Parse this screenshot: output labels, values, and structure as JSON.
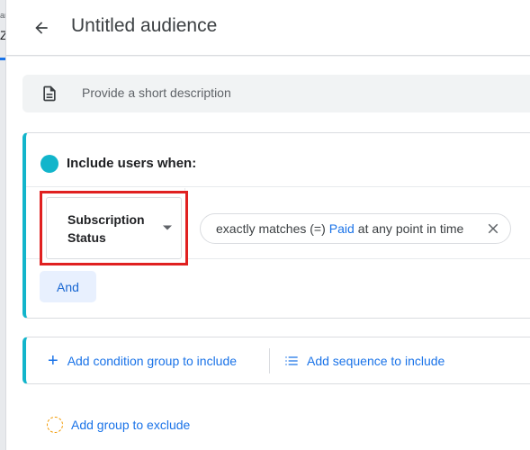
{
  "left_strip": {
    "text_top": "ar",
    "text_mid": "Z"
  },
  "header": {
    "title": "Untitled audience"
  },
  "description": {
    "placeholder": "Provide a short description"
  },
  "include_group": {
    "label": "Include users when:",
    "condition": {
      "dimension": "Subscription Status",
      "operator": "exactly matches (=)",
      "value": "Paid",
      "scope": "at any point in time"
    },
    "and_label": "And"
  },
  "add_actions": {
    "condition_group": "Add condition group to include",
    "sequence": "Add sequence to include"
  },
  "exclude": {
    "label": "Add group to exclude"
  },
  "colors": {
    "accent": "#1a73e8",
    "include_teal": "#12b5cb",
    "highlight_red": "#e02020",
    "exclude_orange": "#f29900"
  }
}
